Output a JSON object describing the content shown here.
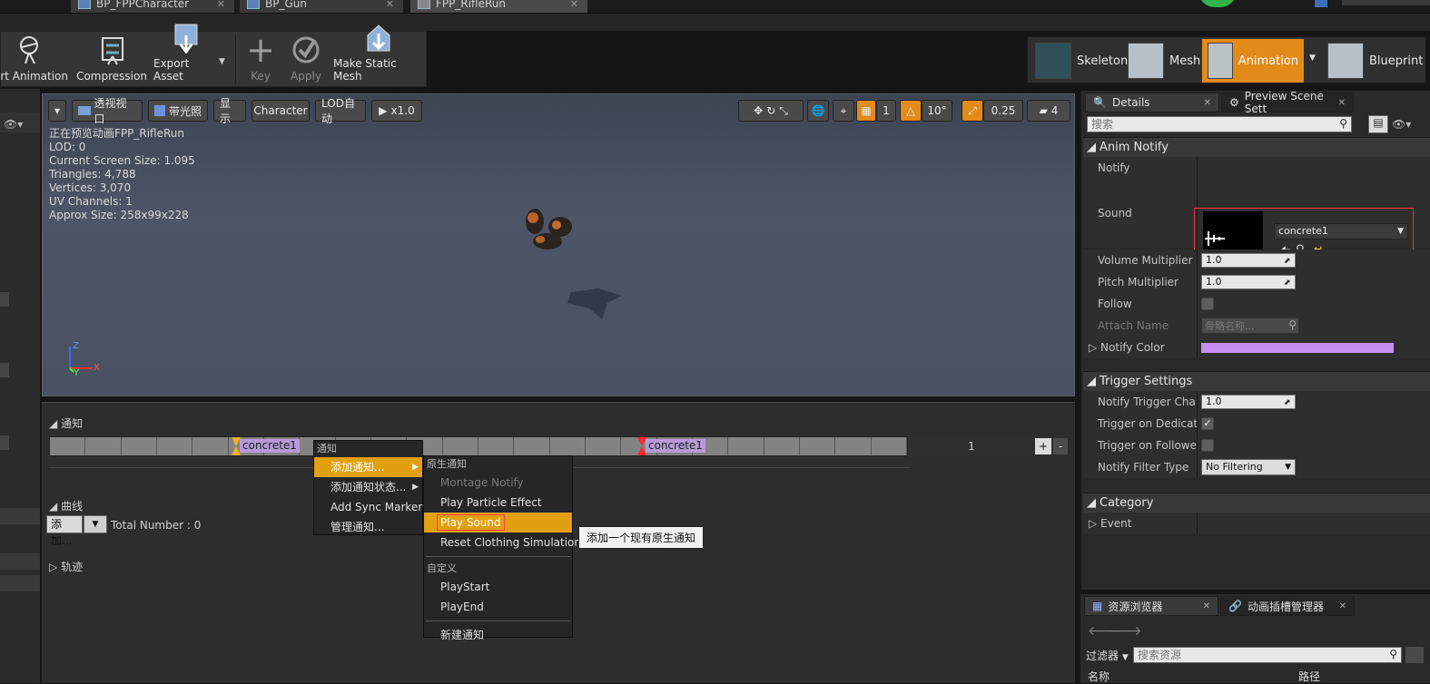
{
  "doc_tabs": [
    {
      "label": "BP_FPPCharacter"
    },
    {
      "label": "BP_Gun"
    },
    {
      "label": "FPP_RifleRun"
    }
  ],
  "toolbar": {
    "export_animation": "ort Animation",
    "compression": "Compression",
    "export_asset": "Export Asset",
    "key": "Key",
    "apply": "Apply",
    "make_static_mesh": "Make Static Mesh"
  },
  "modes": {
    "skeleton": "Skeleton",
    "mesh": "Mesh",
    "animation": "Animation",
    "blueprint": "Blueprint"
  },
  "viewport": {
    "perspective": "透视视口",
    "lit": "带光照",
    "show": "显示",
    "character": "Character",
    "lod": "LOD自动",
    "speed": "x1.0",
    "grid_snap": "1",
    "rot_snap": "10°",
    "scale_snap": "0.25",
    "cam_speed": "4",
    "info": [
      "正在预览动画FPP_RifleRun",
      "LOD: 0",
      "Current Screen Size: 1.095",
      "Triangles: 4,788",
      "Vertices: 3,070",
      "UV Channels: 1",
      "Approx Size: 258x99x228"
    ],
    "axis_z": "Z",
    "axis_x": "X",
    "axis_y": "Y"
  },
  "timeline": {
    "notify_header": "通知",
    "notify_chip_1": "concrete1",
    "notify_chip_2": "concrete1",
    "track_number": "1",
    "plus": "+",
    "minus": "-",
    "curves_header": "曲线",
    "add_label": "添加...",
    "total_number": "Total Number : 0",
    "tracks_header": "轨迹"
  },
  "context_menu": {
    "header": "通知",
    "items": [
      "添加通知...",
      "添加通知状态...",
      "Add Sync Marker",
      "管理通知..."
    ]
  },
  "sub_menu": {
    "native_header": "原生通知",
    "native_items": [
      "Montage Notify",
      "Play Particle Effect",
      "Play Sound",
      "Reset Clothing Simulation"
    ],
    "custom_header": "自定义",
    "custom_items": [
      "PlayStart",
      "PlayEnd"
    ],
    "new_notify": "新建通知"
  },
  "tooltip": "添加一个现有原生通知",
  "details": {
    "tab_details": "Details",
    "tab_preview": "Preview Scene Sett",
    "search_placeholder": "搜索",
    "anim_notify": "Anim Notify",
    "notify_label": "Notify",
    "sound_label": "Sound",
    "sound_value": "concrete1",
    "volume_label": "Volume Multiplier",
    "volume_value": "1.0",
    "pitch_label": "Pitch Multiplier",
    "pitch_value": "1.0",
    "follow_label": "Follow",
    "attach_label": "Attach Name",
    "attach_placeholder": "骨骼名称...",
    "notify_color_label": "Notify Color",
    "notify_color": "#c98ff0",
    "trigger_settings": "Trigger Settings",
    "trigger_chance_label": "Notify Trigger Chance",
    "trigger_chance_value": "1.0",
    "trigger_dedicated_label": "Trigger on Dedicated S",
    "trigger_follower_label": "Trigger on Follower",
    "filter_type_label": "Notify Filter Type",
    "filter_type_value": "No Filtering",
    "category": "Category",
    "event_label": "Event"
  },
  "content_browser": {
    "tab_assets": "资源浏览器",
    "tab_slots": "动画插槽管理器",
    "filter": "过滤器",
    "search_placeholder": "搜索资源",
    "col_name": "名称",
    "col_path": "路径"
  },
  "colors": {
    "accent": "#e38b1a",
    "highlight": "#e2a010",
    "notify_chip": "#b79ad8"
  }
}
